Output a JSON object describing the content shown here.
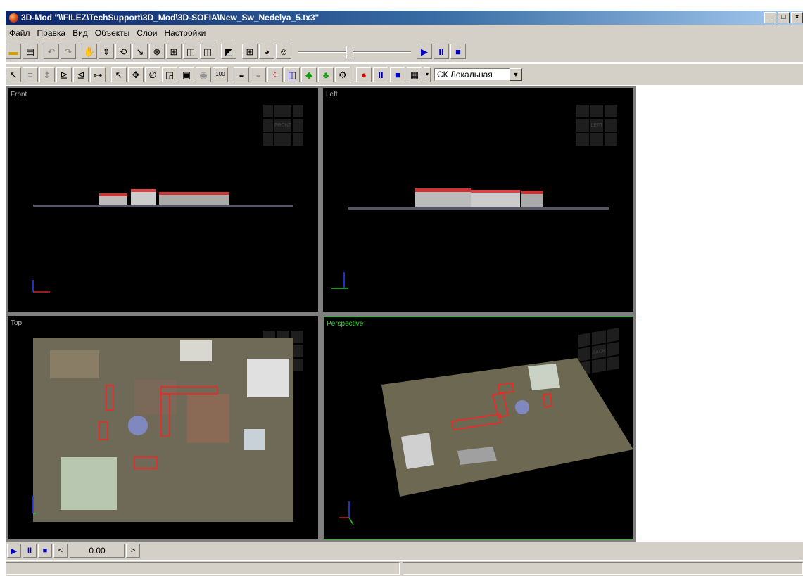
{
  "window": {
    "title": "3D-Mod \"\\\\FILEZ\\TechSupport\\3D_Mod\\3D-SOFIA\\New_Sw_Nedelya_5.tx3\"",
    "buttons": {
      "minimize": "_",
      "maximize": "□",
      "close": "×"
    }
  },
  "menu": {
    "items": [
      "Файл",
      "Правка",
      "Вид",
      "Объекты",
      "Слои",
      "Настройки"
    ]
  },
  "toolbar1": {
    "icons": [
      "open-folder-icon",
      "save-icon",
      "undo-icon",
      "redo-icon",
      "hand-pan-icon",
      "walk-icon",
      "orbit-icon",
      "fly-icon",
      "zoom-icon",
      "zoom-window-icon",
      "box-view-icon",
      "box-view-alt-icon",
      "select-region-icon",
      "layout-grid-icon",
      "glasses-icon",
      "person-icon"
    ],
    "slider_value": 0.45,
    "play": "▶",
    "pause": "II",
    "stop": "■"
  },
  "toolbar2": {
    "coord_system": "СК Локальная"
  },
  "viewports": {
    "front": {
      "label": "Front",
      "cube_label": "FRONT"
    },
    "left": {
      "label": "Left",
      "cube_label": "LEFT"
    },
    "top": {
      "label": "Top"
    },
    "perspective": {
      "label": "Perspective",
      "cube_label": "BACK"
    }
  },
  "playback": {
    "play": "▶",
    "pause": "II",
    "stop": "■",
    "prev": "<",
    "time": "0.00",
    "next": ">"
  },
  "colors": {
    "accent_green": "#20c020",
    "title_gradient_start": "#0a246a",
    "panel": "#d4d0c8"
  }
}
